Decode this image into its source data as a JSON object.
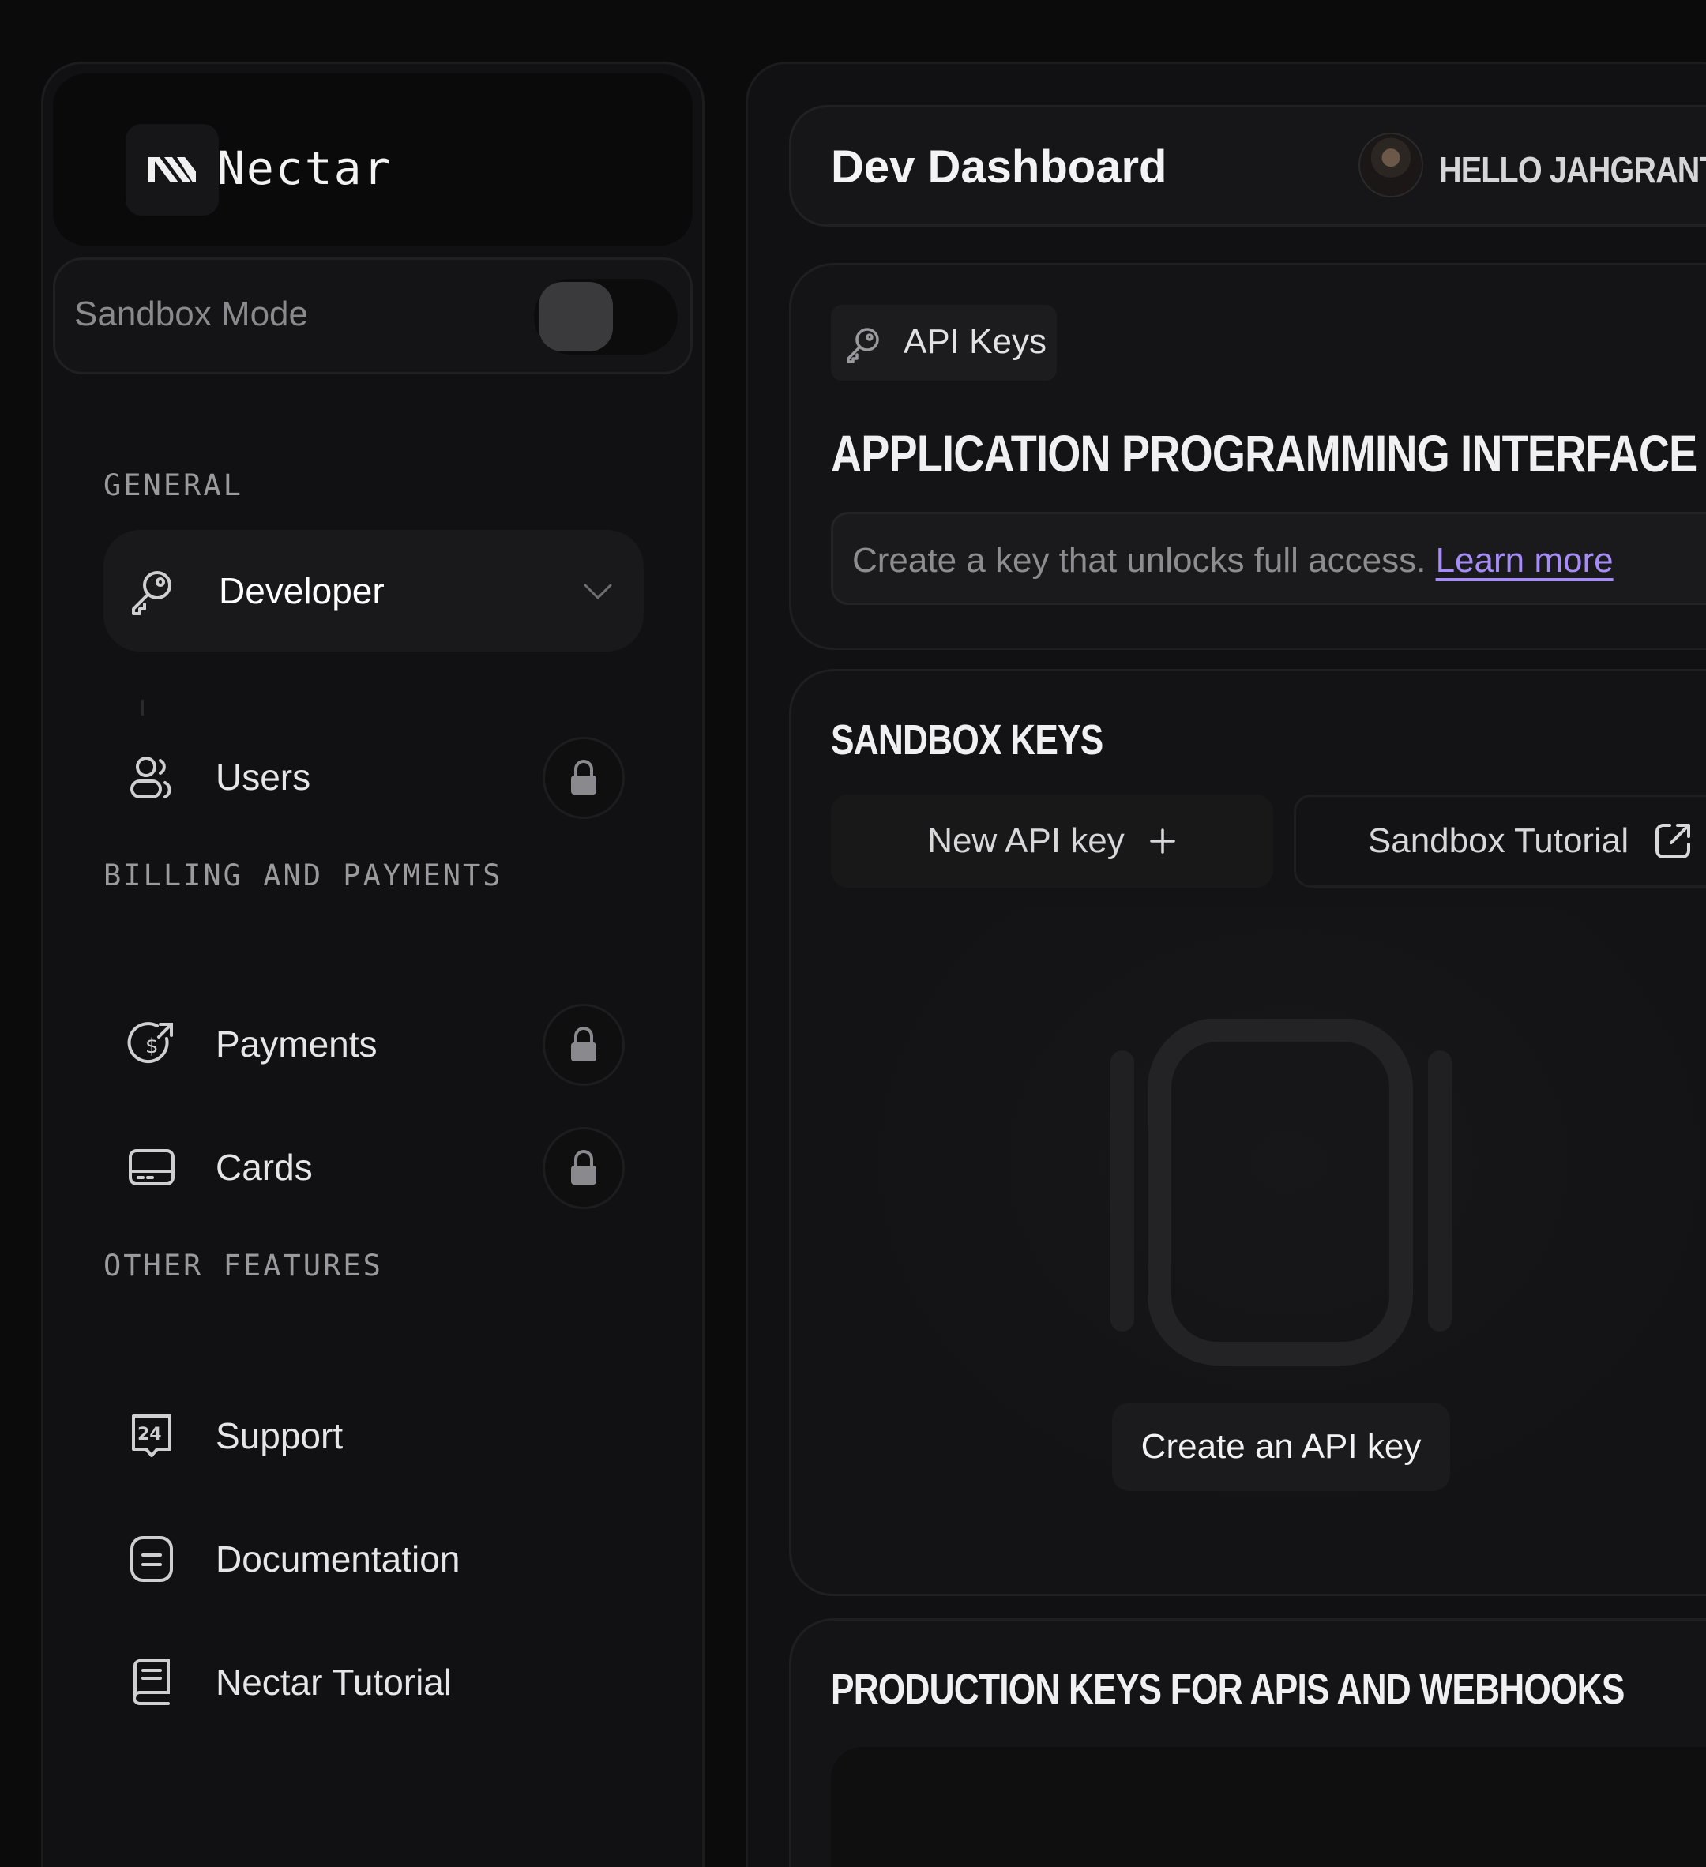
{
  "brand": {
    "name": "Nectar",
    "logo_icon": "nectar-logo-icon"
  },
  "sandbox": {
    "label": "Sandbox Mode",
    "enabled": false
  },
  "sidebar": {
    "sections": [
      {
        "title": "GENERAL"
      },
      {
        "title": "BILLING AND PAYMENTS"
      },
      {
        "title": "OTHER FEATURES"
      }
    ],
    "items": [
      {
        "label": "Developer",
        "icon": "key-icon",
        "active": true
      },
      {
        "label": "Users",
        "icon": "users-icon",
        "locked": true
      },
      {
        "label": "Payments",
        "icon": "payments-icon",
        "locked": true
      },
      {
        "label": "Cards",
        "icon": "card-icon",
        "locked": true
      },
      {
        "label": "Support",
        "icon": "support-24-icon"
      },
      {
        "label": "Documentation",
        "icon": "document-icon"
      },
      {
        "label": "Nectar Tutorial",
        "icon": "tutorial-icon"
      }
    ]
  },
  "header": {
    "title": "Dev Dashboard",
    "greeting": "HELLO JAHGRANT"
  },
  "api_section": {
    "chip_label": "API Keys",
    "heading": "APPLICATION PROGRAMMING INTERFACE",
    "info_text": "Create a key that unlocks full access.",
    "learn_more": "Learn more"
  },
  "sandbox_keys": {
    "heading": "SANDBOX KEYS",
    "new_key_label": "New API key",
    "tutorial_label": "Sandbox Tutorial",
    "create_label": "Create an API key"
  },
  "production_keys": {
    "heading": "PRODUCTION KEYS FOR APIS AND WEBHOOKS"
  },
  "colors": {
    "accent_link": "#a58cf6",
    "background": "#0b0b0c",
    "panel": "#111113"
  }
}
